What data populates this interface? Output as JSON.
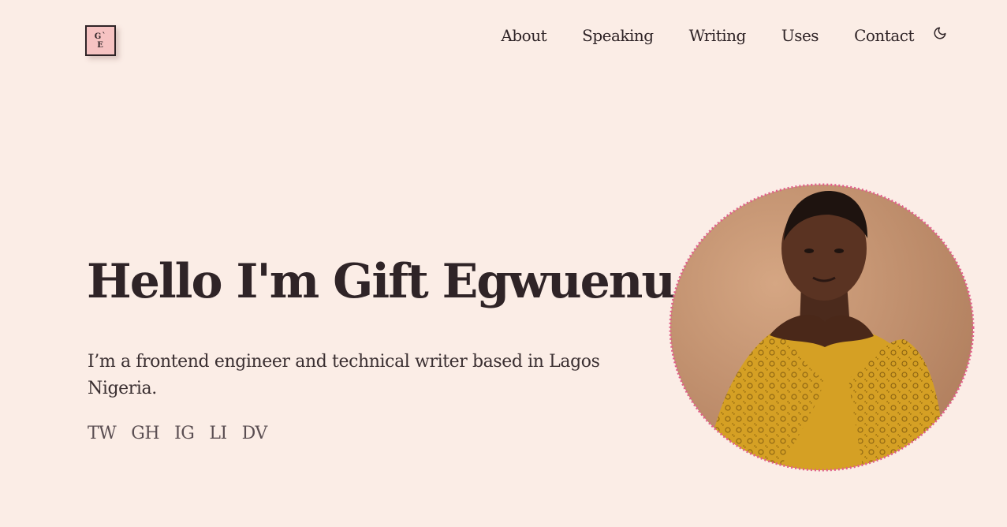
{
  "logo": {
    "line1": "G`",
    "line2": "E"
  },
  "nav": {
    "items": [
      {
        "label": "About"
      },
      {
        "label": "Speaking"
      },
      {
        "label": "Writing"
      },
      {
        "label": "Uses"
      },
      {
        "label": "Contact"
      }
    ],
    "theme_icon": "moon-icon"
  },
  "hero": {
    "title": "Hello I'm Gift Egwuenu",
    "intro": "I’m a frontend engineer and technical writer based in Lagos Nigeria.",
    "socials": [
      {
        "label": "TW"
      },
      {
        "label": "GH"
      },
      {
        "label": "IG"
      },
      {
        "label": "LI"
      },
      {
        "label": "DV"
      }
    ]
  },
  "colors": {
    "background": "#fbede6",
    "text": "#2f2427",
    "logo_fill": "#f6c3c2",
    "portrait_border": "#e0608a",
    "portrait_bg": "#c89572",
    "dress": "#d5a024"
  }
}
